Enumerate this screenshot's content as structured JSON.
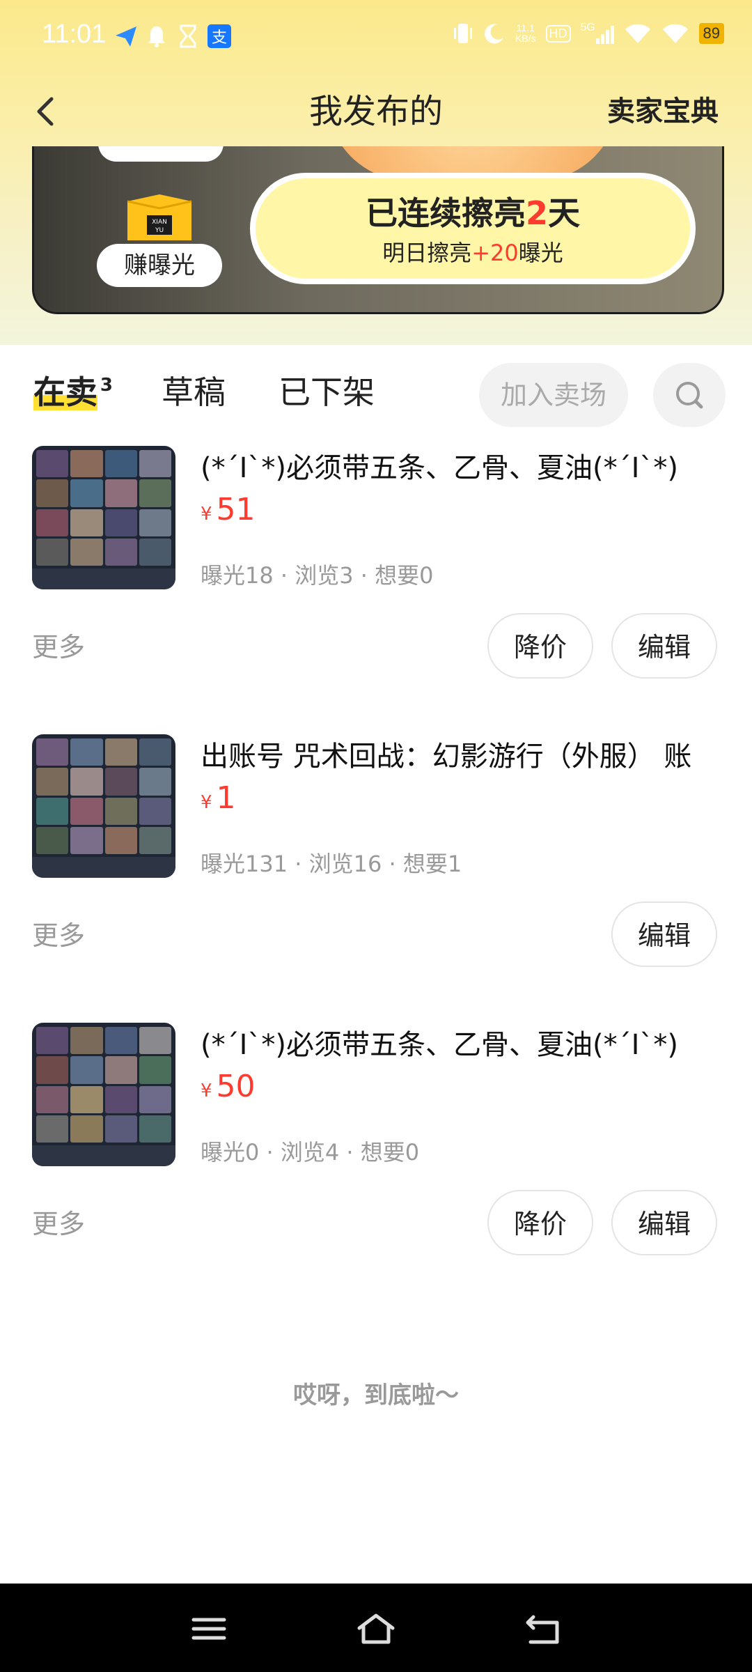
{
  "status_bar": {
    "time": "11:01",
    "net_speed_top": "11.1",
    "net_speed_unit": "KB/s",
    "hd_label": "HD",
    "signal_label": "5G",
    "battery": "89"
  },
  "navbar": {
    "title": "我发布的",
    "right_link": "卖家宝典"
  },
  "banner": {
    "box_icon_text_line1": "XIAN",
    "box_icon_text_line2": "YU",
    "earn_label": "赚曝光",
    "streak_prefix": "已连续擦亮",
    "streak_days": "2",
    "streak_suffix": "天",
    "tomorrow_prefix": "明日擦亮",
    "tomorrow_bonus": "+20",
    "tomorrow_suffix": "曝光"
  },
  "tabs": {
    "items": [
      {
        "label": "在卖",
        "count": "3",
        "active": true
      },
      {
        "label": "草稿",
        "active": false
      },
      {
        "label": "已下架",
        "active": false
      }
    ],
    "join_button": "加入卖场"
  },
  "listings": [
    {
      "title": "(*´I`*)必须带五条、乙骨、夏油(*´I`*)",
      "currency": "¥",
      "price": "51",
      "stats": "曝光18 · 浏览3 · 想要0",
      "more": "更多",
      "buttons": [
        "降价",
        "编辑"
      ]
    },
    {
      "title": "出账号 咒术回战：幻影游行（外服） 账",
      "currency": "¥",
      "price": "1",
      "stats": "曝光131 · 浏览16 · 想要1",
      "more": "更多",
      "buttons": [
        "编辑"
      ]
    },
    {
      "title": "(*´I`*)必须带五条、乙骨、夏油(*´I`*)",
      "currency": "¥",
      "price": "50",
      "stats": "曝光0 · 浏览4 · 想要0",
      "more": "更多",
      "buttons": [
        "降价",
        "编辑"
      ]
    }
  ],
  "end_text": "哎呀，到底啦～",
  "colors": {
    "accent_yellow": "#ffe033",
    "price_red": "#ff3b30",
    "muted_gray": "#999999"
  }
}
